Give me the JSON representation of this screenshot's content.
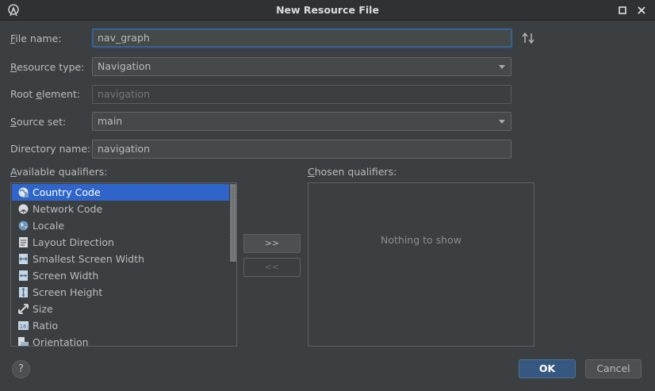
{
  "window": {
    "title": "New Resource File"
  },
  "form": {
    "file_name": {
      "label": "File name:",
      "mnemonic": "F",
      "rest": "ile name:",
      "value": "nav_graph"
    },
    "resource_type": {
      "label": "Resource type:",
      "mnemonic": "R",
      "rest": "esource type:",
      "value": "Navigation"
    },
    "root_element": {
      "label": "Root element:",
      "pre": "Root ",
      "mnemonic": "e",
      "rest": "lement:",
      "placeholder": "navigation"
    },
    "source_set": {
      "label": "Source set:",
      "mnemonic": "S",
      "rest": "ource set:",
      "value": "main"
    },
    "directory_name": {
      "label": "Directory name:",
      "value": "navigation"
    }
  },
  "qualifiers": {
    "available_label": {
      "pre": "",
      "mnemonic": "A",
      "rest": "vailable qualifiers:"
    },
    "chosen_label": {
      "mnemonic": "C",
      "rest": "hosen qualifiers:"
    },
    "available": [
      {
        "label": "Country Code",
        "icon": "country-code-icon",
        "selected": true
      },
      {
        "label": "Network Code",
        "icon": "network-code-icon"
      },
      {
        "label": "Locale",
        "icon": "globe-icon"
      },
      {
        "label": "Layout Direction",
        "icon": "layout-direction-icon"
      },
      {
        "label": "Smallest Screen Width",
        "icon": "smallest-width-icon"
      },
      {
        "label": "Screen Width",
        "icon": "screen-width-icon"
      },
      {
        "label": "Screen Height",
        "icon": "screen-height-icon"
      },
      {
        "label": "Size",
        "icon": "size-icon"
      },
      {
        "label": "Ratio",
        "icon": "ratio-icon"
      },
      {
        "label": "Orientation",
        "icon": "orientation-icon"
      }
    ],
    "chosen_empty_text": "Nothing to show",
    "add_button": ">>",
    "remove_button": "<<"
  },
  "buttons": {
    "help": "?",
    "ok": "OK",
    "cancel": "Cancel"
  },
  "colors": {
    "background": "#3c3f41",
    "selection": "#2f65ca",
    "ok_button": "#365880",
    "focus_border": "#3d6185"
  }
}
